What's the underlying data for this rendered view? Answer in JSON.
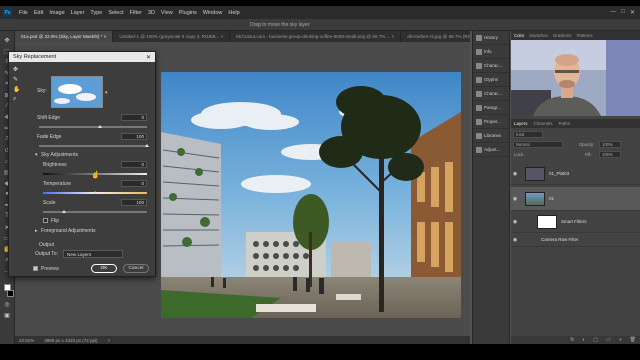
{
  "menu": {
    "logo": "Ps",
    "items": [
      "File",
      "Edit",
      "Image",
      "Layer",
      "Type",
      "Select",
      "Filter",
      "3D",
      "View",
      "Plugins",
      "Window",
      "Help"
    ],
    "window_controls": [
      "—",
      "□",
      "✕"
    ]
  },
  "options_hint": "Drag to move the sky layer",
  "tabs": [
    {
      "label": "01a.psd @ 22.9% (Sky, Layer Mask/8) *  ×",
      "active": true
    },
    {
      "label": "Untitled-1 @ 100% (grayscale II copy 3, RGB/8...  ×",
      "active": false
    },
    {
      "label": "MrCutout.com - business-group-drinking-coffee-0008-small.png @ 66.7% ...  ×",
      "active": false
    },
    {
      "label": "dirt-before-r2.jpg @ 66.7% (RGB/8...  ×",
      "active": false
    }
  ],
  "status": {
    "zoom": "22.91%",
    "doc": "3989 px x 4320 px (72 ppi)",
    "arrow": ">"
  },
  "dialog": {
    "title": "Sky Replacement",
    "close": "✕",
    "sky_label": "Sky:",
    "shift_edge": {
      "label": "Shift Edge",
      "value": "0"
    },
    "fade_edge": {
      "label": "Fade Edge",
      "value": "100"
    },
    "sky_adjustments": "Sky Adjustments",
    "brightness": {
      "label": "Brightness",
      "value": "0"
    },
    "temperature": {
      "label": "Temperature",
      "value": "0"
    },
    "scale": {
      "label": "Scale",
      "value": "100"
    },
    "flip": "Flip",
    "foreground_adjustments": "Foreground Adjustments",
    "output_heading": "Output",
    "output_to": {
      "label": "Output To:",
      "value": "New Layers"
    },
    "preview": "Preview",
    "ok": "OK",
    "cancel": "Cancel",
    "slider_levels": {
      "shift_edge": 0.55,
      "fade_edge": 1.0,
      "brightness": 0.5,
      "temperature": 0.5,
      "scale": 0.2
    }
  },
  "dock": [
    "History",
    "Info",
    "Charac...",
    "Glyphs",
    "Charac...",
    "Paragr...",
    "Proper...",
    "Libraries",
    "Adjust..."
  ],
  "color_tabs": [
    "Color",
    "Swatches",
    "Gradients",
    "Patterns"
  ],
  "layers": {
    "tabs": [
      "Layers",
      "Channels",
      "Paths"
    ],
    "kind_label": "Kind",
    "blend_label": "Normal",
    "opacity_label": "Opacity:",
    "opacity_value": "100%",
    "lock_label": "Lock:",
    "fill_label": "Fill:",
    "fill_value": "100%",
    "rows": [
      {
        "name": "01_Plat03",
        "selected": false
      },
      {
        "name": "01",
        "selected": true
      },
      {
        "name": "Smart Filters",
        "selected": false
      },
      {
        "name": "Camera Raw Filter",
        "selected": false
      }
    ],
    "footer_icons": [
      "fx",
      "◐",
      "▢",
      "▭",
      "+",
      "🗑"
    ]
  },
  "colors": {
    "accent": "#31a8ff",
    "app_bg": "#535353",
    "panel": "#434343",
    "menu": "#2b2b2b"
  }
}
